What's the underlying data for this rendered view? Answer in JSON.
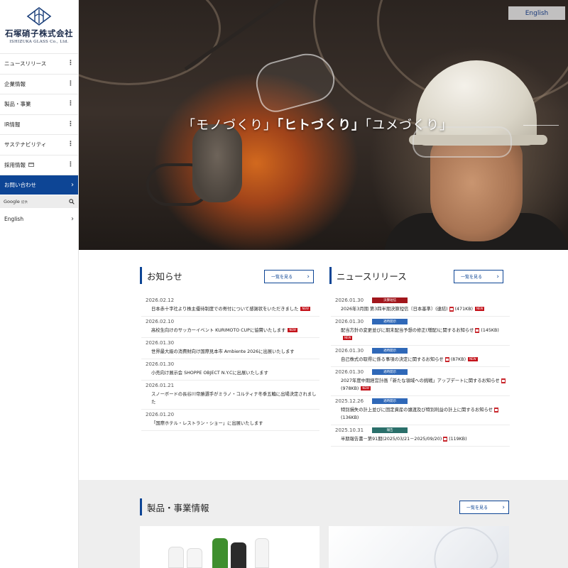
{
  "logo": {
    "company_ja": "石塚硝子株式会社",
    "company_en": "ISHIZUKA GLASS Co., Ltd."
  },
  "sidebar": {
    "items": [
      {
        "label": "ニュースリリース"
      },
      {
        "label": "企業情報"
      },
      {
        "label": "製品・事業"
      },
      {
        "label": "IR情報"
      },
      {
        "label": "サステナビリティ"
      },
      {
        "label": "採用情報"
      }
    ],
    "contact_label": "お問い合わせ",
    "search": {
      "google_label": "Google",
      "google_sub": "提供"
    },
    "english_label": "English"
  },
  "hero": {
    "english_button": "English",
    "copy_1": "「モノづくり」",
    "copy_2": "「ヒトづくり」",
    "copy_3": "「ユメづくり」"
  },
  "notices": {
    "title": "お知らせ",
    "more_label": "一覧を見る",
    "items": [
      {
        "date": "2026.02.12",
        "text": "日本赤十字社より株主優待制度での寄付について感謝状をいただきました",
        "new": true
      },
      {
        "date": "2026.02.10",
        "text": "高校生向けのサッカーイベント KURIMOTO CUPに協賛いたします",
        "new": true
      },
      {
        "date": "2026.01.30",
        "text": "世界最大級の消費財向け国際見本市 Ambiente 2026に出展いたします",
        "new": false
      },
      {
        "date": "2026.01.30",
        "text": "小売向け展示会 SHOPPE OBJECT N.Y.Cに出展いたします",
        "new": false
      },
      {
        "date": "2026.01.21",
        "text": "スノーボードの長谷川帝勝選手がミラノ・コルティナ冬季五輪に出場決定されました",
        "new": false
      },
      {
        "date": "2026.01.20",
        "text": "「国際ホテル・レストラン・ショー」に出展いたします",
        "new": false
      }
    ]
  },
  "releases": {
    "title": "ニュースリリース",
    "more_label": "一覧を見る",
    "new_label": "NEW",
    "items": [
      {
        "date": "2026.01.30",
        "category": "決算短信",
        "cat_color": "red",
        "text": "2026年3月期 第3四半期決算短信〔日本基準〕(連結)",
        "size": "(471KB)",
        "new": true
      },
      {
        "date": "2026.01.30",
        "category": "適時開示",
        "cat_color": "blue",
        "text": "配当方針の変更並びに期末配当予想の修正(増配)に関するお知らせ",
        "size": "(145KB)",
        "new": true
      },
      {
        "date": "2026.01.30",
        "category": "適時開示",
        "cat_color": "blue",
        "text": "自己株式の取得に係る事項の決定に関するお知らせ",
        "size": "(87KB)",
        "new": true
      },
      {
        "date": "2026.01.30",
        "category": "適時開示",
        "cat_color": "blue",
        "text": "2027年度中期経営計画「新たな領域への挑戦」アップデートに関するお知らせ",
        "size": "(978KB)",
        "new": true
      },
      {
        "date": "2025.12.26",
        "category": "適時開示",
        "cat_color": "blue",
        "text": "特別損失の計上並びに固定資産の譲渡及び特別利益の計上に関するお知らせ",
        "size": "(136KB)",
        "new": false
      },
      {
        "date": "2025.10.31",
        "category": "報告",
        "cat_color": "teal",
        "text": "半期報告書－第91期(2025/03/21－2025/09/20)",
        "size": "(119KB)",
        "new": false
      }
    ]
  },
  "products": {
    "title": "製品・事業情報",
    "more_label": "一覧を見る"
  },
  "colors": {
    "brand_blue": "#0d4595",
    "new_red": "#c4121a"
  }
}
